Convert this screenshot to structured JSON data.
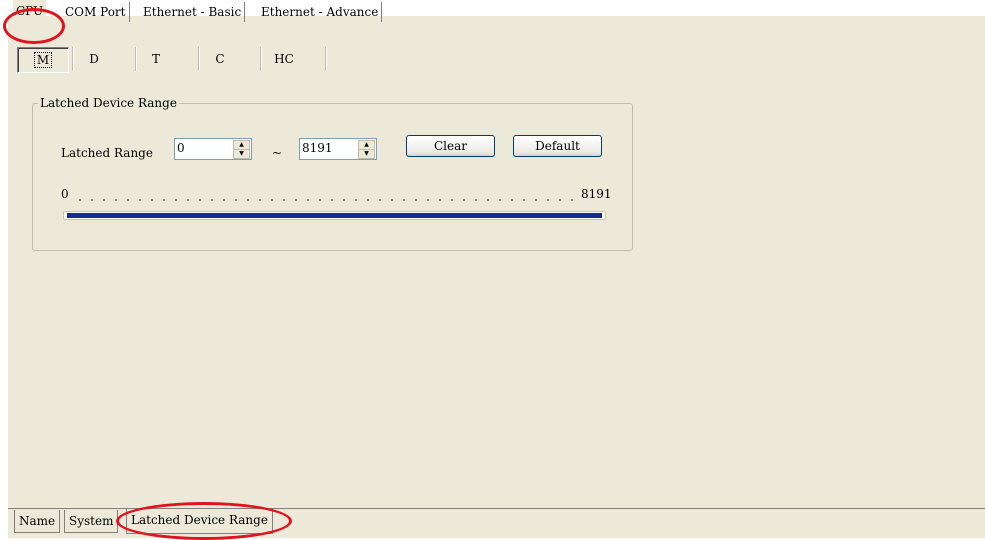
{
  "top_tabs": [
    "CPU",
    "COM Port",
    "Ethernet - Basic",
    "Ethernet - Advance"
  ],
  "sub_tabs": [
    "M",
    "D",
    "T",
    "C",
    "HC"
  ],
  "group": {
    "title": "Latched Device Range",
    "range_label": "Latched Range",
    "start_value": "0",
    "tilde": "~",
    "end_value": "8191",
    "clear_label": "Clear",
    "default_label": "Default"
  },
  "slider": {
    "min_label": "0",
    "max_label": "8191",
    "range_fraction": 1.0
  },
  "bottom_tabs": [
    "Name",
    "System",
    "Latched Device Range"
  ],
  "colors": {
    "panel_bg": "#ece9d8",
    "slider_fill": "#1a2b8f",
    "highlight_ring": "#e0141e"
  }
}
